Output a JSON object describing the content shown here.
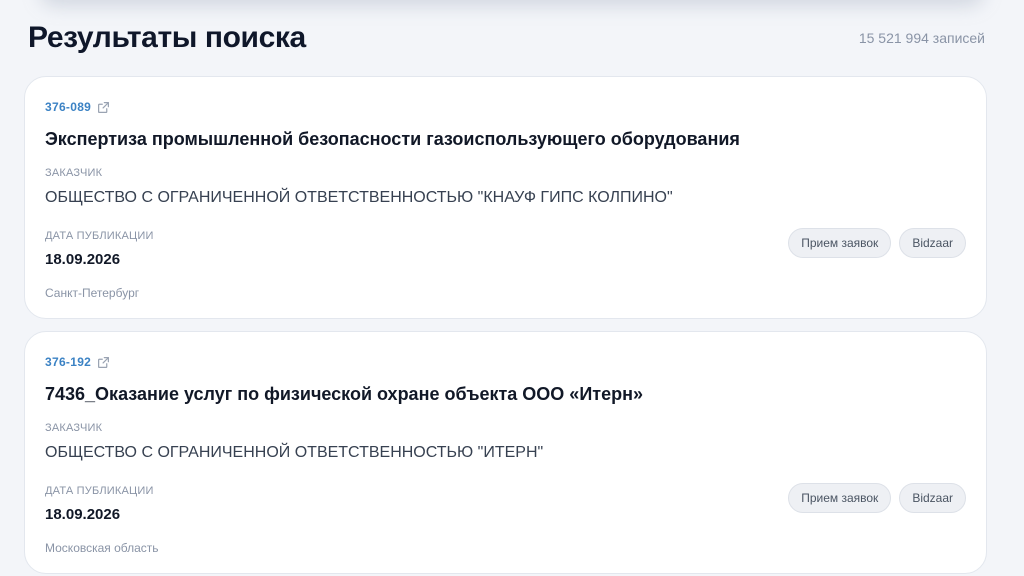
{
  "header": {
    "title": "Результаты поиска",
    "count": "15 521 994 записей"
  },
  "results": [
    {
      "id": "376-089",
      "title": "Экспертиза промышленной безопасности газоиспользующего оборудования",
      "customer_label": "ЗАКАЗЧИК",
      "customer": "ОБЩЕСТВО С ОГРАНИЧЕННОЙ ОТВЕТСТВЕННОСТЬЮ \"КНАУФ ГИПС КОЛПИНО\"",
      "date_label": "ДАТА ПУБЛИКАЦИИ",
      "date": "18.09.2026",
      "region": "Санкт-Петербург",
      "tags": [
        "Прием заявок",
        "Bidzaar"
      ]
    },
    {
      "id": "376-192",
      "title": "7436_Оказание услуг по физической охране объекта ООО «Итерн»",
      "customer_label": "ЗАКАЗЧИК",
      "customer": "ОБЩЕСТВО С ОГРАНИЧЕННОЙ ОТВЕТСТВЕННОСТЬЮ \"ИТЕРН\"",
      "date_label": "ДАТА ПУБЛИКАЦИИ",
      "date": "18.09.2026",
      "region": "Московская область",
      "tags": [
        "Прием заявок",
        "Bidzaar"
      ]
    }
  ],
  "icons": {
    "external_link": "external-link-icon"
  },
  "colors": {
    "accent": "#3b82c4",
    "background": "#f3f5f9",
    "card": "#ffffff"
  }
}
